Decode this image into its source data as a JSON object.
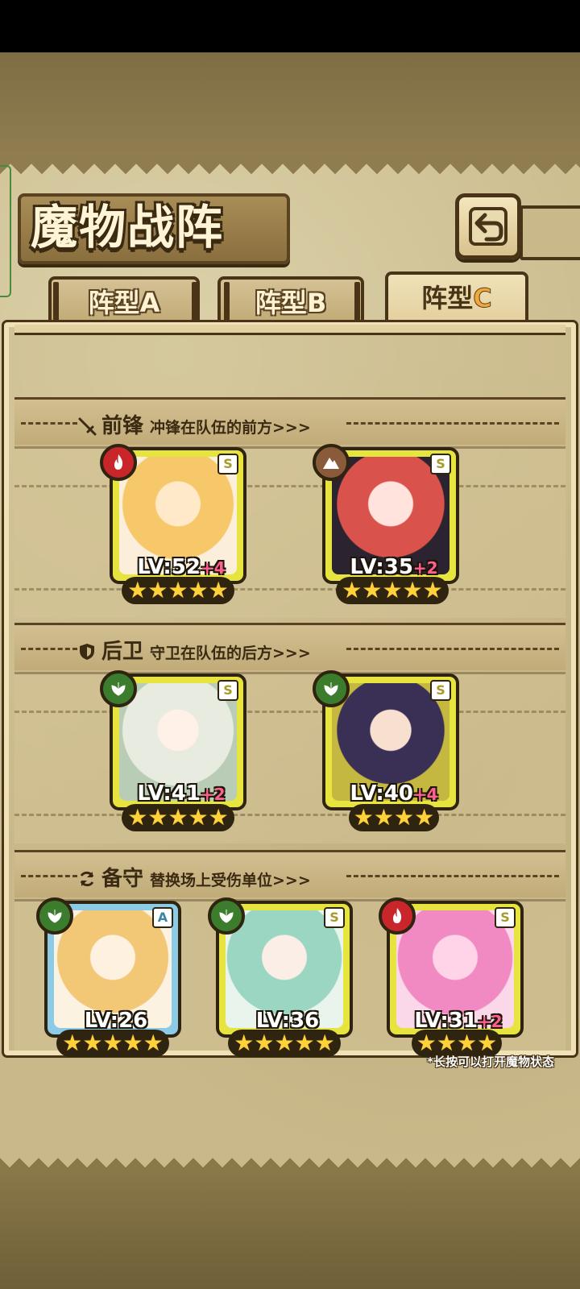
{
  "title": "魔物战阵",
  "tabs": [
    {
      "label": "阵型",
      "suffix": "A",
      "active": false
    },
    {
      "label": "阵型",
      "suffix": "B",
      "active": false
    },
    {
      "label": "阵型",
      "suffix": "C",
      "active": true
    }
  ],
  "sections": {
    "front": {
      "title": "前锋",
      "desc": "冲锋在队伍的前方>>>",
      "icon": "sword-icon"
    },
    "back": {
      "title": "后卫",
      "desc": "守卫在队伍的后方>>>",
      "icon": "shield-icon"
    },
    "reserve": {
      "title": "备守",
      "desc": "替换场上受伤单位>>>",
      "icon": "refresh-icon"
    }
  },
  "units": {
    "front_1": {
      "element": "fire",
      "grade": "S",
      "level": "LV:52",
      "plus": "+4",
      "stars": "★★★★★"
    },
    "front_2": {
      "element": "earth",
      "grade": "S",
      "level": "LV:35",
      "plus": "+2",
      "stars": "★★★★★"
    },
    "back_1": {
      "element": "plant",
      "grade": "S",
      "level": "LV:41",
      "plus": "+2",
      "stars": "★★★★★"
    },
    "back_2": {
      "element": "plant",
      "grade": "S",
      "level": "LV:40",
      "plus": "+4",
      "stars": "★★★★"
    },
    "reserve_1": {
      "element": "plant",
      "grade": "A",
      "level": "LV:26",
      "plus": "",
      "stars": "★★★★★"
    },
    "reserve_2": {
      "element": "plant",
      "grade": "S",
      "level": "LV:36",
      "plus": "",
      "stars": "★★★★★"
    },
    "reserve_3": {
      "element": "fire",
      "grade": "S",
      "level": "LV:31",
      "plus": "+2",
      "stars": "★★★★"
    }
  },
  "hint": "*长按可以打开魔物状态",
  "colors": {
    "card_gold": "#e7e33f",
    "card_blue": "#8ccbe6",
    "fire": "#c8262a",
    "earth": "#8a5b3a",
    "plant": "#3b7d2c",
    "parchment": "#c9b98a"
  }
}
